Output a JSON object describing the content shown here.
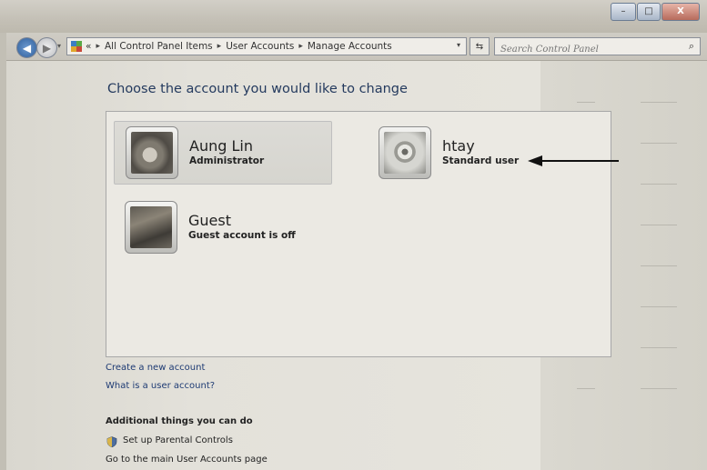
{
  "window": {
    "minimize_glyph": "–",
    "maximize_glyph": "□",
    "close_glyph": "X"
  },
  "navigation": {
    "back_glyph": "◀",
    "forward_glyph": "▶",
    "dropdown_glyph": "▾",
    "refresh_glyph": "⇆"
  },
  "address_bar": {
    "prefix": "«",
    "breadcrumbs": [
      "All Control Panel Items",
      "User Accounts",
      "Manage Accounts"
    ],
    "separator": "▸"
  },
  "search": {
    "placeholder": "Search Control Panel",
    "icon_glyph": "⌕"
  },
  "main": {
    "heading": "Choose the account you would like to change",
    "accounts": [
      {
        "name": "Aung Lin",
        "role": "Administrator",
        "icon": "cat-picture-icon"
      },
      {
        "name": "htay",
        "role": "Standard user",
        "icon": "flower-picture-icon"
      },
      {
        "name": "Guest",
        "role": "Guest account is off",
        "icon": "chess-picture-icon"
      }
    ],
    "links": [
      "Create a new account",
      "What is a user account?"
    ],
    "additional_title": "Additional things you can do",
    "additional_links": [
      "Set up Parental Controls",
      "Go to the main User Accounts page"
    ]
  },
  "colors": {
    "link": "#1d3a73",
    "heading": "#243a5e",
    "annotation_arrow": "#111111"
  }
}
